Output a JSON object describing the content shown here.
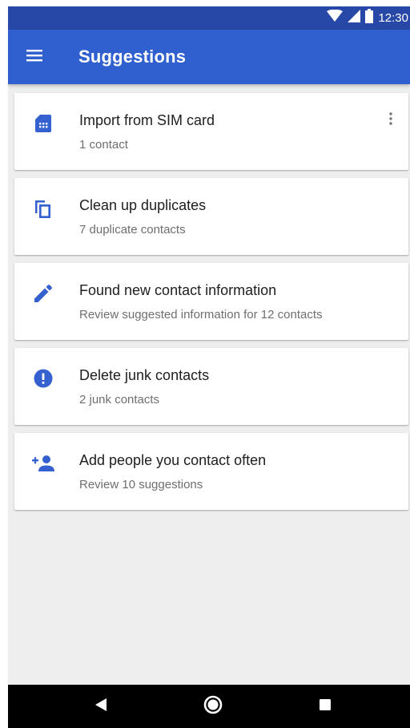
{
  "status_bar": {
    "time": "12:30",
    "icons": [
      "wifi-icon",
      "cell-signal-icon",
      "battery-icon"
    ]
  },
  "app_bar": {
    "title": "Suggestions",
    "menu_icon": "hamburger-menu-icon"
  },
  "suggestions": [
    {
      "title": "Import from SIM card",
      "subtitle": "1 contact",
      "icon": "sim-card-icon"
    },
    {
      "title": "Clean up duplicates",
      "subtitle": "7 duplicate contacts",
      "icon": "duplicate-icon"
    },
    {
      "title": "Found new contact information",
      "subtitle": "Review suggested information for 12 contacts",
      "icon": "pencil-icon"
    },
    {
      "title": "Delete junk contacts",
      "subtitle": "2 junk contacts",
      "icon": "alert-icon"
    },
    {
      "title": "Add people you contact often",
      "subtitle": "Review 10 suggestions",
      "icon": "add-person-icon"
    }
  ],
  "nav_bar": {
    "icons": [
      "back-icon",
      "home-icon",
      "recents-icon"
    ]
  },
  "colors": {
    "status_bar": "#2748a6",
    "app_bar": "#3060d0",
    "accent": "#3461cf",
    "background": "#eeeeee",
    "card": "#ffffff"
  }
}
